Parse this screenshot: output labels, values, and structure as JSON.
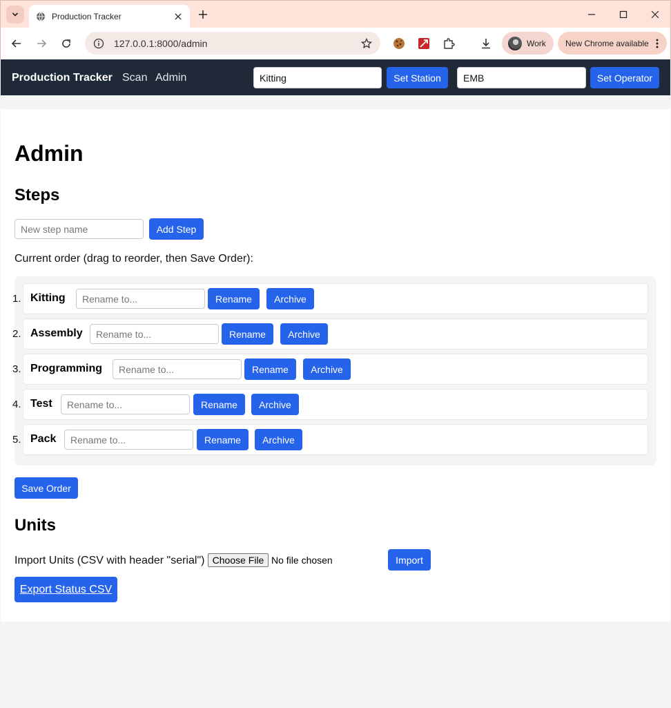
{
  "browser": {
    "tab_title": "Production Tracker",
    "url": "127.0.0.1:8000/admin",
    "profile_label": "Work",
    "update_label": "New Chrome available"
  },
  "nav": {
    "brand": "Production Tracker",
    "links": [
      "Scan",
      "Admin"
    ],
    "station_value": "Kitting",
    "set_station_label": "Set Station",
    "operator_value": "EMB",
    "set_operator_label": "Set Operator"
  },
  "admin": {
    "title": "Admin",
    "steps_heading": "Steps",
    "new_step_placeholder": "New step name",
    "add_step_label": "Add Step",
    "order_hint": "Current order (drag to reorder, then Save Order):",
    "steps": [
      {
        "num": "1.",
        "name": "Kitting"
      },
      {
        "num": "2.",
        "name": "Assembly"
      },
      {
        "num": "3.",
        "name": "Programming"
      },
      {
        "num": "4.",
        "name": "Test"
      },
      {
        "num": "5.",
        "name": "Pack"
      }
    ],
    "rename_placeholder": "Rename to...",
    "rename_label": "Rename",
    "archive_label": "Archive",
    "save_order_label": "Save Order",
    "units_heading": "Units",
    "import_label": "Import Units (CSV with header \"serial\")",
    "choose_file_label": "Choose File",
    "file_status": "No file chosen",
    "import_button_label": "Import",
    "export_label": "Export Status CSV"
  },
  "colors": {
    "nav_bg": "#1f2937",
    "primary": "#2563eb",
    "tabstrip_bg": "#fde3da"
  }
}
